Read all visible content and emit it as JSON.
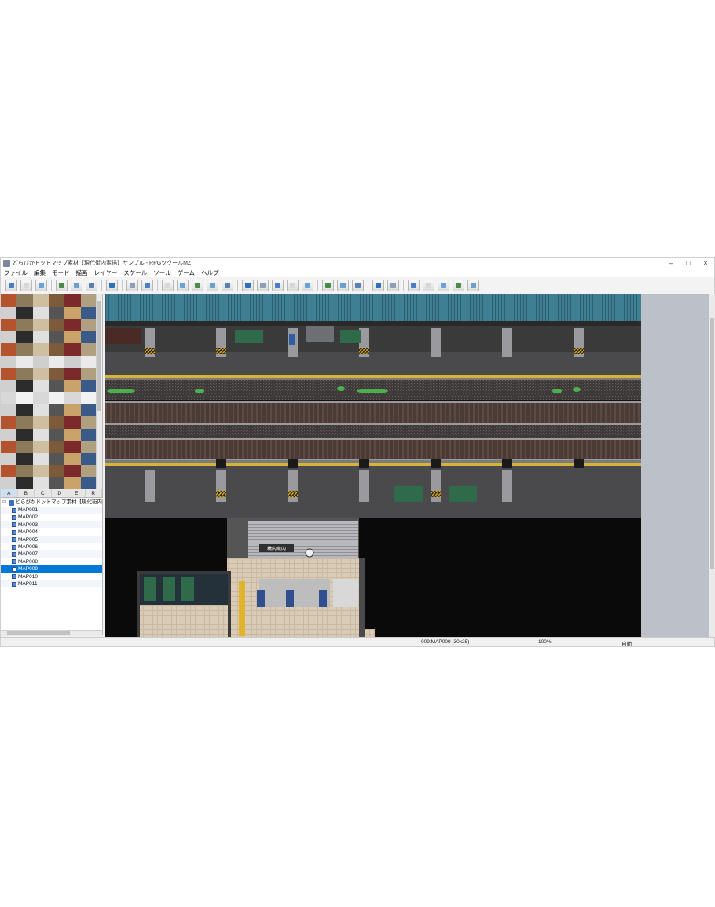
{
  "window": {
    "title": "どらぴかドットマップ素材【現代街内素描】サンプル - RPGツクールMZ",
    "controls": {
      "minimize": "–",
      "maximize": "□",
      "close": "×"
    }
  },
  "menu": [
    "ファイル",
    "編集",
    "モード",
    "描画",
    "レイヤー",
    "スケール",
    "ツール",
    "ゲーム",
    "ヘルプ"
  ],
  "toolbar": {
    "icons": [
      "new-project-icon",
      "open-project-icon",
      "save-project-icon",
      "cut-icon",
      "copy-icon",
      "paste-icon",
      "undo-icon",
      "map-mode-icon",
      "event-mode-icon",
      "layer-auto-icon",
      "layer-1-icon",
      "layer-2-icon",
      "layer-3-icon",
      "layer-4-icon",
      "pencil-icon",
      "rectangle-icon",
      "ellipse-icon",
      "flood-fill-icon",
      "shadow-pen-icon",
      "zoom-in-icon",
      "zoom-out-icon",
      "zoom-actual-icon",
      "database-icon",
      "plugin-manager-icon",
      "sound-test-icon",
      "event-searcher-icon",
      "character-generator-icon",
      "resource-manager-icon",
      "playtest-icon"
    ]
  },
  "tileset_tabs": [
    "A",
    "B",
    "C",
    "D",
    "E",
    "R"
  ],
  "active_tileset_tab": "A",
  "map_tree": {
    "root": "どらぴかドットマップ素材【現代街内",
    "maps": [
      "MAP001",
      "MAP002",
      "MAP003",
      "MAP004",
      "MAP005",
      "MAP006",
      "MAP007",
      "MAP008",
      "MAP009",
      "MAP010",
      "MAP011"
    ],
    "selected": "MAP009"
  },
  "map_scene": {
    "sign_text": "構内案内"
  },
  "status": {
    "map_info": "009:MAP009 (30x25)",
    "zoom": "100%",
    "mode": "自動"
  },
  "colors": {
    "selection": "#0078d7",
    "roof": "#3f7f93",
    "platform": "#4a4a4c",
    "tactile": "#d6b43a",
    "track": "#4b3b36",
    "floor_tile": "#d9cbb6"
  }
}
